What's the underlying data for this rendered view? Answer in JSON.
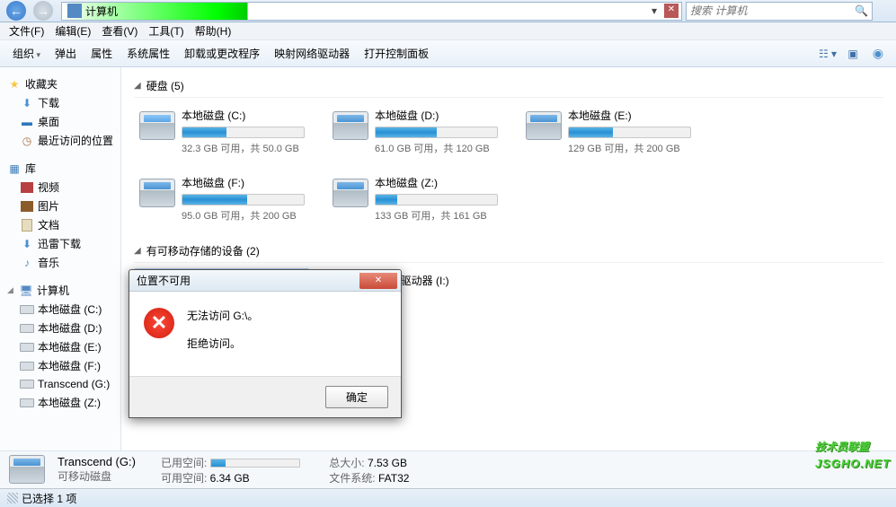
{
  "titlebar": {
    "location": "计算机",
    "search_placeholder": "搜索 计算机"
  },
  "menubar": [
    "文件(F)",
    "编辑(E)",
    "查看(V)",
    "工具(T)",
    "帮助(H)"
  ],
  "toolbar": {
    "items": [
      "组织",
      "弹出",
      "属性",
      "系统属性",
      "卸载或更改程序",
      "映射网络驱动器",
      "打开控制面板"
    ]
  },
  "sidebar": {
    "groups": [
      {
        "header": "收藏夹",
        "icon": "star",
        "items": [
          {
            "label": "下载",
            "icon": "dl"
          },
          {
            "label": "桌面",
            "icon": "desk"
          },
          {
            "label": "最近访问的位置",
            "icon": "recent"
          }
        ]
      },
      {
        "header": "库",
        "icon": "lib",
        "items": [
          {
            "label": "视频",
            "icon": "vid"
          },
          {
            "label": "图片",
            "icon": "pic"
          },
          {
            "label": "文档",
            "icon": "doc"
          },
          {
            "label": "迅雷下载",
            "icon": "dl"
          },
          {
            "label": "音乐",
            "icon": "music"
          }
        ]
      },
      {
        "header": "计算机",
        "icon": "comp",
        "expanded": true,
        "items": [
          {
            "label": "本地磁盘 (C:)",
            "icon": "drive"
          },
          {
            "label": "本地磁盘 (D:)",
            "icon": "drive"
          },
          {
            "label": "本地磁盘 (E:)",
            "icon": "drive"
          },
          {
            "label": "本地磁盘 (F:)",
            "icon": "drive"
          },
          {
            "label": "Transcend (G:)",
            "icon": "drive"
          },
          {
            "label": "本地磁盘 (Z:)",
            "icon": "drive"
          }
        ]
      }
    ]
  },
  "content": {
    "sections": [
      {
        "title": "硬盘 (5)",
        "drives": [
          {
            "name": "本地磁盘 (C:)",
            "stats": "32.3 GB 可用，共 50.0 GB",
            "fill": 36,
            "win": true
          },
          {
            "name": "本地磁盘 (D:)",
            "stats": "61.0 GB 可用，共 120 GB",
            "fill": 50
          },
          {
            "name": "本地磁盘 (E:)",
            "stats": "129 GB 可用，共 200 GB",
            "fill": 36
          },
          {
            "name": "本地磁盘 (F:)",
            "stats": "95.0 GB 可用，共 200 GB",
            "fill": 53
          },
          {
            "name": "本地磁盘 (Z:)",
            "stats": "133 GB 可用，共 161 GB",
            "fill": 18
          }
        ]
      },
      {
        "title": "有可移动存储的设备 (2)",
        "drives": [
          {
            "name": "Transcend (G:)",
            "stats": "6.34 GB 可用，共 7.53 GB",
            "fill": 16,
            "selected": true
          },
          {
            "name": "DVD 驱动器 (I:)",
            "type": "dvd"
          }
        ]
      }
    ]
  },
  "dialog": {
    "title": "位置不可用",
    "line1": "无法访问 G:\\。",
    "line2": "拒绝访问。",
    "ok": "确定"
  },
  "details": {
    "name": "Transcend (G:)",
    "type": "可移动磁盘",
    "used_label": "已用空间:",
    "free_label": "可用空间:",
    "free_val": "6.34 GB",
    "total_label": "总大小:",
    "total_val": "7.53 GB",
    "fs_label": "文件系统:",
    "fs_val": "FAT32"
  },
  "status": "已选择 1 项",
  "watermark": {
    "main": "技术员联盟",
    "sub": "JSGHO.NET"
  }
}
